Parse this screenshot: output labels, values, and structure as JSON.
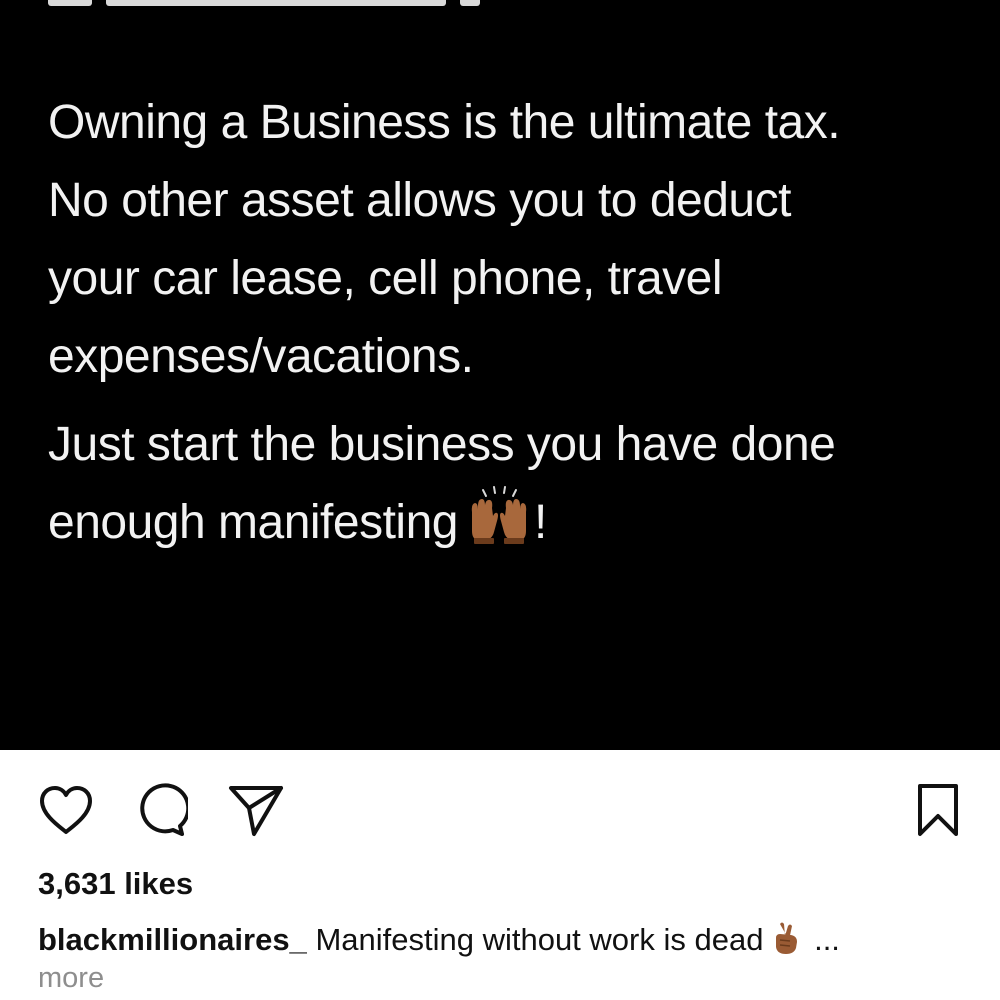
{
  "post": {
    "paragraph1_lines": [
      "Owning a Business is the ultimate tax.",
      "No other asset allows you to deduct",
      "your car lease, cell phone, travel",
      "expenses/vacations."
    ],
    "paragraph2_line1": "Just start the business you have done",
    "paragraph2_line2_before": "enough manifesting",
    "paragraph2_line2_emoji": "raising-hands-emoji",
    "paragraph2_line2_after": "!",
    "background_color": "#000000",
    "text_color": "#f2f2f2"
  },
  "actions": {
    "icons": [
      "heart-icon",
      "comment-icon",
      "share-icon",
      "bookmark-icon"
    ]
  },
  "likes": {
    "text": "3,631 likes"
  },
  "caption": {
    "username": "blackmillionaires_",
    "text": "Manifesting without work is dead",
    "emoji": "crossed-fingers-emoji",
    "ellipsis": "...",
    "more_label": "more"
  }
}
